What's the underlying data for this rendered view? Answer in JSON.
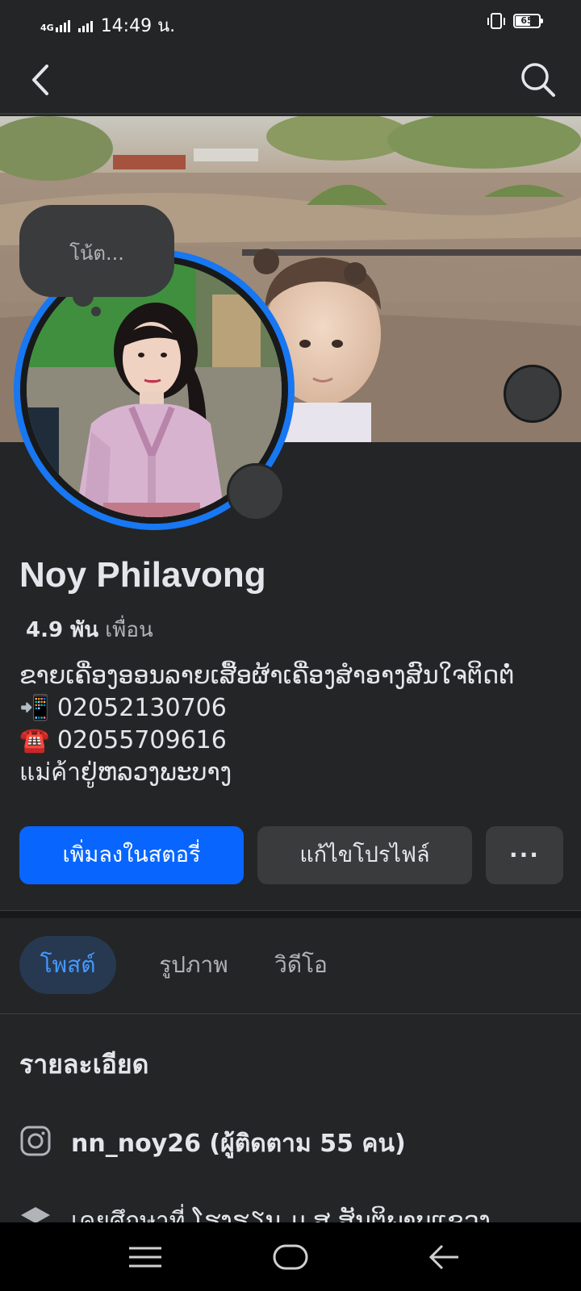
{
  "status_bar": {
    "network": "4G",
    "time": "14:49 น.",
    "battery": "65"
  },
  "header": {
    "back_icon": "chevron-left-icon",
    "search_icon": "search-icon"
  },
  "note": {
    "placeholder": "โน้ต..."
  },
  "profile": {
    "name": "Noy Philavong",
    "friends_count": "4.9 พัน",
    "friends_label": "เพื่อน",
    "bio": [
      "ຂາຍເຄື່ອງອອນລາຍເສື້ອຜ້າເຄື່ອງສຳອາງສົນໃຈຕິດຕໍ່",
      "📲 02052130706",
      "☎️ 02055709616",
      "แม่ค้าຢູ່ຫລວງພະບາງ"
    ]
  },
  "actions": {
    "add_story": "เพิ่มลงในสตอรี่",
    "edit_profile": "แก้ไขโปรไฟล์",
    "more": "···"
  },
  "tabs": {
    "posts": "โพสต์",
    "photos": "รูปภาพ",
    "videos": "วิดีโอ"
  },
  "details": {
    "title": "รายละเอียด",
    "instagram": "nn_noy26 (ผู้ติดตาม 55 คน)",
    "education": "เคยศึกษาที่ ໂຮງຮຽນ ມ.ສ ສັນຕິພາບແຂວງ"
  },
  "colors": {
    "background": "#242526",
    "accent": "#0866ff",
    "tab_active_bg": "#263951",
    "tab_active_text": "#4599ff",
    "avatar_ring": "#1877f2"
  }
}
